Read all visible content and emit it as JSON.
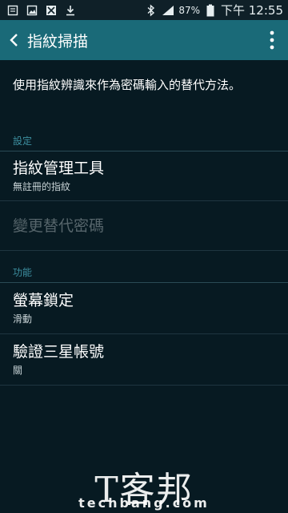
{
  "status_bar": {
    "battery_percent": "87%",
    "time": "下午 12:55",
    "icons": [
      "notes-icon",
      "image-icon",
      "blocked-icon",
      "download-icon",
      "bluetooth-icon",
      "signal-icon",
      "battery-icon"
    ]
  },
  "app_bar": {
    "title": "指紋掃描",
    "back_icon": "chevron-left-icon",
    "menu_icon": "more-vert-icon"
  },
  "description": "使用指紋辨識來作為密碼輸入的替代方法。",
  "sections": [
    {
      "header": "設定",
      "items": [
        {
          "title": "指紋管理工具",
          "subtitle": "無註冊的指紋",
          "enabled": true
        },
        {
          "title": "變更替代密碼",
          "subtitle": "",
          "enabled": false
        }
      ]
    },
    {
      "header": "功能",
      "items": [
        {
          "title": "螢幕鎖定",
          "subtitle": "滑動",
          "enabled": true
        },
        {
          "title": "驗證三星帳號",
          "subtitle": "關",
          "enabled": true
        }
      ]
    }
  ],
  "watermark": {
    "cn": "T客邦",
    "en": "techbang.com"
  },
  "colors": {
    "app_bar": "#1a6a78",
    "background": "#071a22",
    "section_header": "#3d8fa0",
    "disabled_text": "#56656b"
  }
}
